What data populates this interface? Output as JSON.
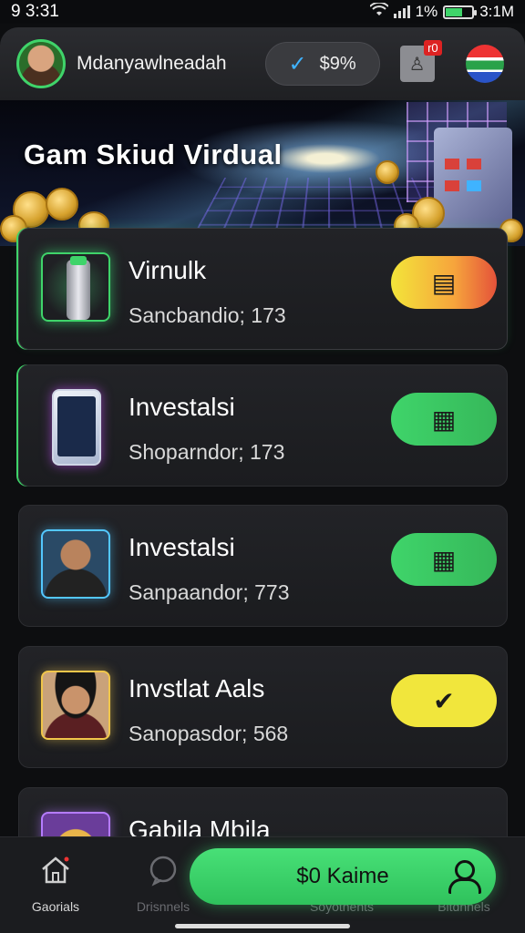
{
  "status_bar": {
    "time": "9 3:31",
    "battery_percent": "1%",
    "battery_time": "3:1M"
  },
  "header": {
    "username": "Mdanyawlneadah",
    "balance": "$9%",
    "notification_badge": "r0"
  },
  "banner": {
    "title": "Gam  Skiud Virdual"
  },
  "cards": [
    {
      "title": "Virnulk",
      "subtitle": "Sancbandio; 173"
    },
    {
      "title": "Investalsi",
      "subtitle": "Shoparndor; 173"
    },
    {
      "title": "Investalsi",
      "subtitle": "Sanpaandor; 773"
    },
    {
      "title": "Invstlat Aals",
      "subtitle": "Sanopasdor; 568"
    },
    {
      "title": "Gabila Mbila",
      "subtitle": ""
    }
  ],
  "bottom_nav": {
    "items": [
      {
        "label": "Gaorials"
      },
      {
        "label": "Drisnnels"
      },
      {
        "label": "Soyotnents"
      },
      {
        "label": "Bitdnnels"
      }
    ],
    "primary_button": "$0 Kaime"
  },
  "colors": {
    "accent_green": "#3fd46a",
    "background": "#0d0e10",
    "card": "#1f2023"
  }
}
